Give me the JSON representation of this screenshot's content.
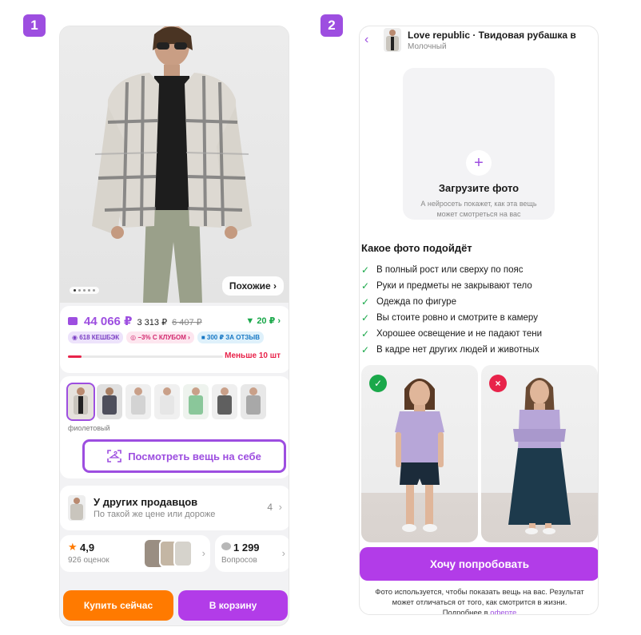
{
  "steps": {
    "first": "1",
    "second": "2"
  },
  "product": {
    "similar_label": "Похожие",
    "price_main": "44 066 ₽",
    "price_alt": "3 313 ₽",
    "price_old": "6 407 ₽",
    "bonus": "20 ₽",
    "badges": [
      "618 КЕШБЭК",
      "−3% С КЛУБОМ",
      "300 ₽ ЗА ОТЗЫВ"
    ],
    "stock_label": "Меньше 10 шт",
    "stock_fraction": 0.09,
    "color_name": "фиолетовый",
    "try_on_label": "Посмотреть вещь на себе",
    "sellers_title": "У других продавцов",
    "sellers_subtitle": "По такой же цене или дороже",
    "sellers_count": "4",
    "rating": "4,9",
    "rating_count": "926 оценок",
    "questions_count": "1 299",
    "questions_label": "Вопросов",
    "buy_now": "Купить сейчас",
    "add_to_cart": "В корзину"
  },
  "tryon": {
    "header_title": "Love republic · Твидовая рубашка в",
    "header_subtitle": "Молочный",
    "upload_title": "Загрузите фото",
    "upload_hint": "А нейросеть покажет, как эта вещь может смотреться на вас",
    "suitable_title": "Какое фото подойдёт",
    "rules": [
      "В полный рост или сверху по пояс",
      "Руки и предметы не закрывают тело",
      "Одежда по фигуре",
      "Вы стоите ровно и смотрите в камеру",
      "Хорошее освещение и не падают тени",
      "В кадре нет других людей и животных"
    ],
    "cta": "Хочу попробовать",
    "disclaimer_1": "Фото используется, чтобы показать вещь на вас. Результат",
    "disclaimer_2": "может отличаться от того, как смотрится в жизни.",
    "disclaimer_3": "Подробнее в",
    "disclaimer_link": "оферте"
  },
  "colors": {
    "accent": "#9d4ee0",
    "button_purple": "#b23ce8",
    "buy_orange": "#ff7a00",
    "check_green": "#1aa84a",
    "cross_red": "#e8234a"
  }
}
